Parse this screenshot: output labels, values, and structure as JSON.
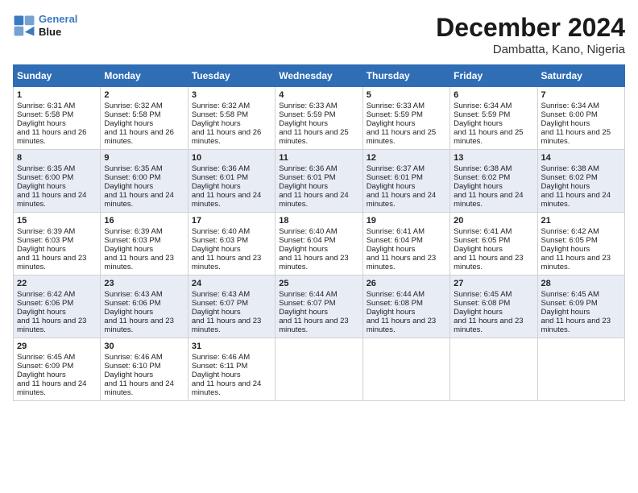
{
  "header": {
    "logo_line1": "General",
    "logo_line2": "Blue",
    "month": "December 2024",
    "location": "Dambatta, Kano, Nigeria"
  },
  "days_of_week": [
    "Sunday",
    "Monday",
    "Tuesday",
    "Wednesday",
    "Thursday",
    "Friday",
    "Saturday"
  ],
  "weeks": [
    [
      {
        "day": "1",
        "sr": "6:31 AM",
        "ss": "5:58 PM",
        "dl": "11 hours and 26 minutes."
      },
      {
        "day": "2",
        "sr": "6:32 AM",
        "ss": "5:58 PM",
        "dl": "11 hours and 26 minutes."
      },
      {
        "day": "3",
        "sr": "6:32 AM",
        "ss": "5:58 PM",
        "dl": "11 hours and 26 minutes."
      },
      {
        "day": "4",
        "sr": "6:33 AM",
        "ss": "5:59 PM",
        "dl": "11 hours and 25 minutes."
      },
      {
        "day": "5",
        "sr": "6:33 AM",
        "ss": "5:59 PM",
        "dl": "11 hours and 25 minutes."
      },
      {
        "day": "6",
        "sr": "6:34 AM",
        "ss": "5:59 PM",
        "dl": "11 hours and 25 minutes."
      },
      {
        "day": "7",
        "sr": "6:34 AM",
        "ss": "6:00 PM",
        "dl": "11 hours and 25 minutes."
      }
    ],
    [
      {
        "day": "8",
        "sr": "6:35 AM",
        "ss": "6:00 PM",
        "dl": "11 hours and 24 minutes."
      },
      {
        "day": "9",
        "sr": "6:35 AM",
        "ss": "6:00 PM",
        "dl": "11 hours and 24 minutes."
      },
      {
        "day": "10",
        "sr": "6:36 AM",
        "ss": "6:01 PM",
        "dl": "11 hours and 24 minutes."
      },
      {
        "day": "11",
        "sr": "6:36 AM",
        "ss": "6:01 PM",
        "dl": "11 hours and 24 minutes."
      },
      {
        "day": "12",
        "sr": "6:37 AM",
        "ss": "6:01 PM",
        "dl": "11 hours and 24 minutes."
      },
      {
        "day": "13",
        "sr": "6:38 AM",
        "ss": "6:02 PM",
        "dl": "11 hours and 24 minutes."
      },
      {
        "day": "14",
        "sr": "6:38 AM",
        "ss": "6:02 PM",
        "dl": "11 hours and 24 minutes."
      }
    ],
    [
      {
        "day": "15",
        "sr": "6:39 AM",
        "ss": "6:03 PM",
        "dl": "11 hours and 23 minutes."
      },
      {
        "day": "16",
        "sr": "6:39 AM",
        "ss": "6:03 PM",
        "dl": "11 hours and 23 minutes."
      },
      {
        "day": "17",
        "sr": "6:40 AM",
        "ss": "6:03 PM",
        "dl": "11 hours and 23 minutes."
      },
      {
        "day": "18",
        "sr": "6:40 AM",
        "ss": "6:04 PM",
        "dl": "11 hours and 23 minutes."
      },
      {
        "day": "19",
        "sr": "6:41 AM",
        "ss": "6:04 PM",
        "dl": "11 hours and 23 minutes."
      },
      {
        "day": "20",
        "sr": "6:41 AM",
        "ss": "6:05 PM",
        "dl": "11 hours and 23 minutes."
      },
      {
        "day": "21",
        "sr": "6:42 AM",
        "ss": "6:05 PM",
        "dl": "11 hours and 23 minutes."
      }
    ],
    [
      {
        "day": "22",
        "sr": "6:42 AM",
        "ss": "6:06 PM",
        "dl": "11 hours and 23 minutes."
      },
      {
        "day": "23",
        "sr": "6:43 AM",
        "ss": "6:06 PM",
        "dl": "11 hours and 23 minutes."
      },
      {
        "day": "24",
        "sr": "6:43 AM",
        "ss": "6:07 PM",
        "dl": "11 hours and 23 minutes."
      },
      {
        "day": "25",
        "sr": "6:44 AM",
        "ss": "6:07 PM",
        "dl": "11 hours and 23 minutes."
      },
      {
        "day": "26",
        "sr": "6:44 AM",
        "ss": "6:08 PM",
        "dl": "11 hours and 23 minutes."
      },
      {
        "day": "27",
        "sr": "6:45 AM",
        "ss": "6:08 PM",
        "dl": "11 hours and 23 minutes."
      },
      {
        "day": "28",
        "sr": "6:45 AM",
        "ss": "6:09 PM",
        "dl": "11 hours and 23 minutes."
      }
    ],
    [
      {
        "day": "29",
        "sr": "6:45 AM",
        "ss": "6:09 PM",
        "dl": "11 hours and 24 minutes."
      },
      {
        "day": "30",
        "sr": "6:46 AM",
        "ss": "6:10 PM",
        "dl": "11 hours and 24 minutes."
      },
      {
        "day": "31",
        "sr": "6:46 AM",
        "ss": "6:11 PM",
        "dl": "11 hours and 24 minutes."
      },
      null,
      null,
      null,
      null
    ]
  ]
}
